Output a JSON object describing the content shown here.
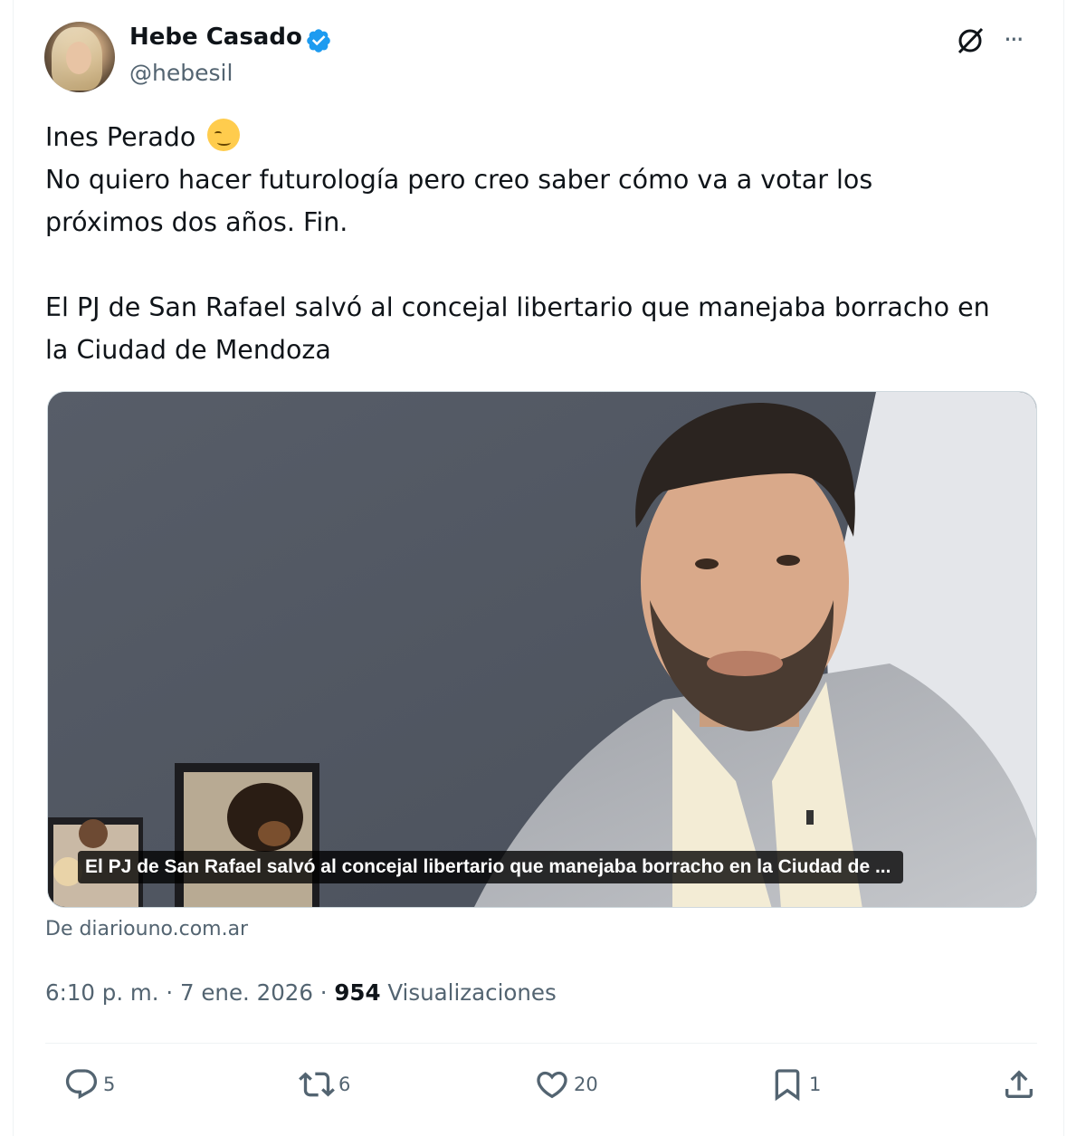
{
  "author": {
    "name": "Hebe Casado",
    "handle": "@hebesil",
    "verified": true
  },
  "tweet": {
    "line1": "Ines Perado",
    "line1_emoji": "smirking-face",
    "body": "No quiero hacer futurología pero creo saber cómo va a votar los\npróximos dos años. Fin.\n\nEl PJ de San Rafael salvó al concejal libertario que manejaba borracho en\nla Ciudad de Mendoza"
  },
  "card": {
    "caption": "El PJ de San Rafael salvó al concejal libertario que manejaba borracho en la Ciudad de ...",
    "source": "De diariouno.com.ar"
  },
  "meta": {
    "time": "6:10 p. m.",
    "date": "7 ene. 2026",
    "views_count": "954",
    "views_label": "Visualizaciones",
    "separator": "·"
  },
  "actions": {
    "replies": "5",
    "reposts": "6",
    "likes": "20",
    "bookmarks": "1"
  },
  "colors": {
    "text": "#0f1419",
    "secondary": "#536471",
    "verified": "#1d9bf0",
    "border": "#eff3f4"
  }
}
